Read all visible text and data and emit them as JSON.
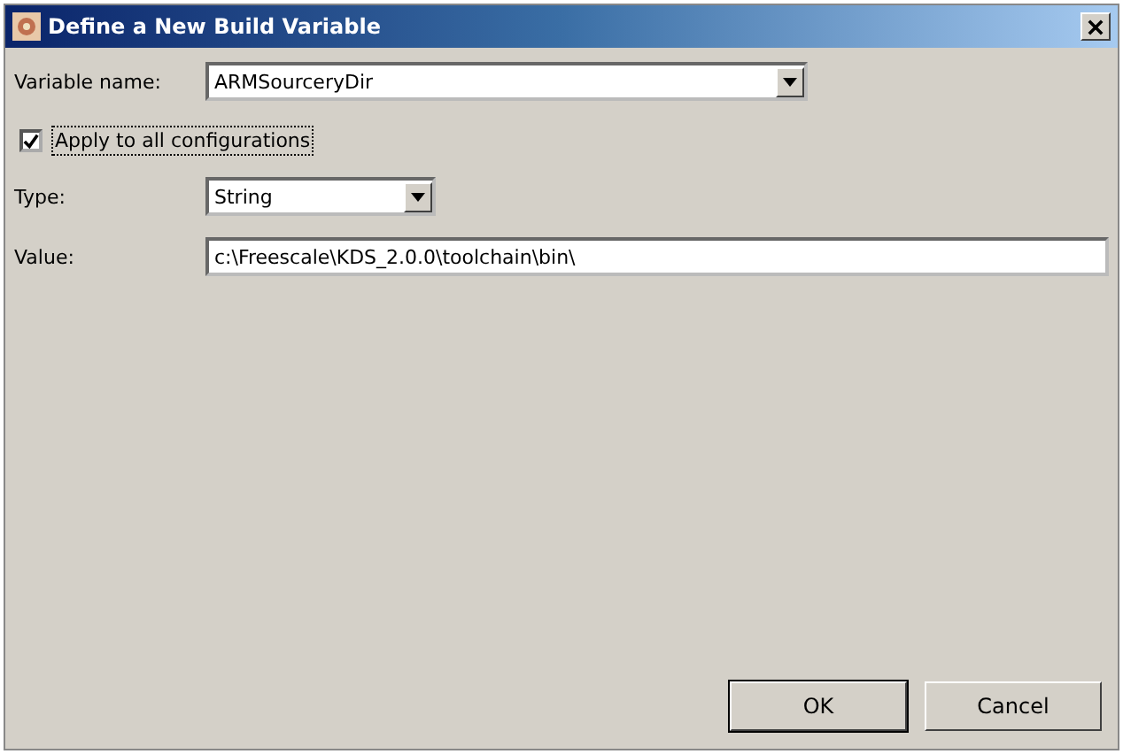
{
  "window": {
    "title": "Define a New Build Variable"
  },
  "variable_name": {
    "label": "Variable name:",
    "value": "ARMSourceryDir"
  },
  "apply_all": {
    "label": "Apply to all configurations",
    "checked": true,
    "focused": true
  },
  "type": {
    "label": "Type:",
    "value": "String"
  },
  "value": {
    "label": "Value:",
    "value": "c:\\Freescale\\KDS_2.0.0\\toolchain\\bin\\"
  },
  "buttons": [
    {
      "label": "OK",
      "default": true
    },
    {
      "label": "Cancel",
      "default": false
    }
  ]
}
